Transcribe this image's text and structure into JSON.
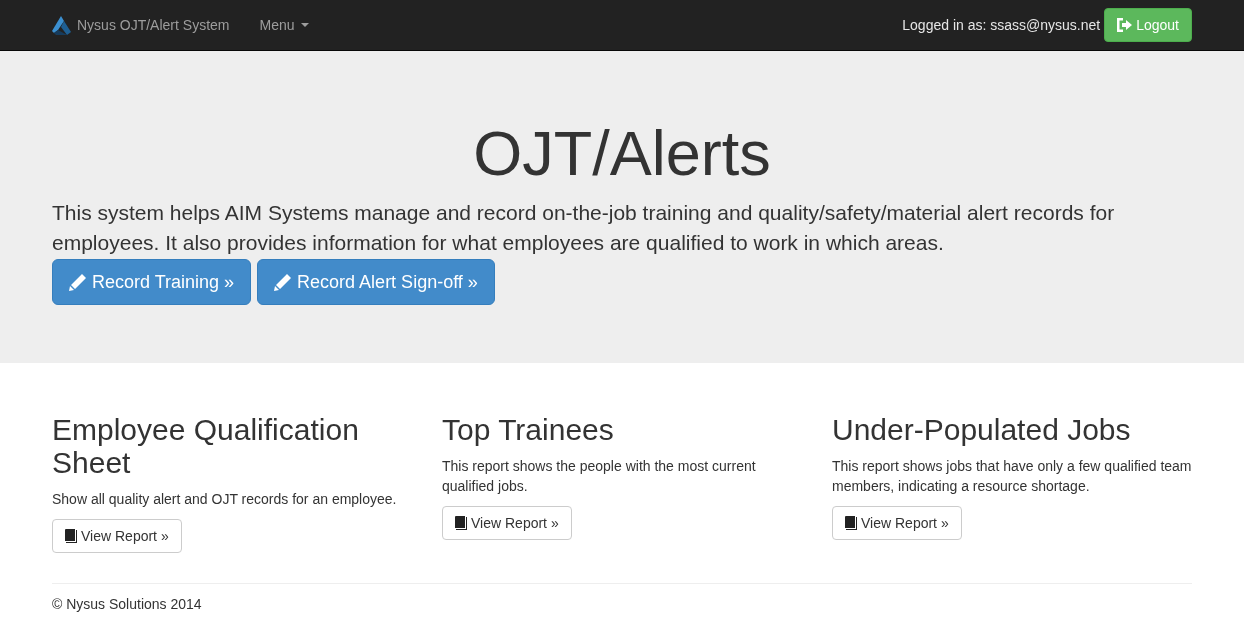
{
  "navbar": {
    "brand": "Nysus OJT/Alert System",
    "menu_label": "Menu",
    "user_text": "Logged in as: ssass@nysus.net",
    "logout_button": "Logout"
  },
  "hero": {
    "title": "OJT/Alerts",
    "description": "This system helps AIM Systems manage and record on-the-job training and quality/safety/material alert records for employees. It also provides information for what employees are qualified to work in which areas.",
    "buttons": [
      "Record Training »",
      "Record Alert Sign-off »"
    ]
  },
  "reports": [
    {
      "title": "Employee Qualification Sheet",
      "description": "Show all quality alert and OJT records for an employee.",
      "button": "View Report »"
    },
    {
      "title": "Top Trainees",
      "description": "This report shows the people with the most current qualified jobs.",
      "button": "View Report »"
    },
    {
      "title": "Under-Populated Jobs",
      "description": "This report shows jobs that have only a few qualified team members, indicating a resource shortage.",
      "button": "View Report »"
    }
  ],
  "footer": {
    "copyright": "© Nysus Solutions 2014"
  }
}
